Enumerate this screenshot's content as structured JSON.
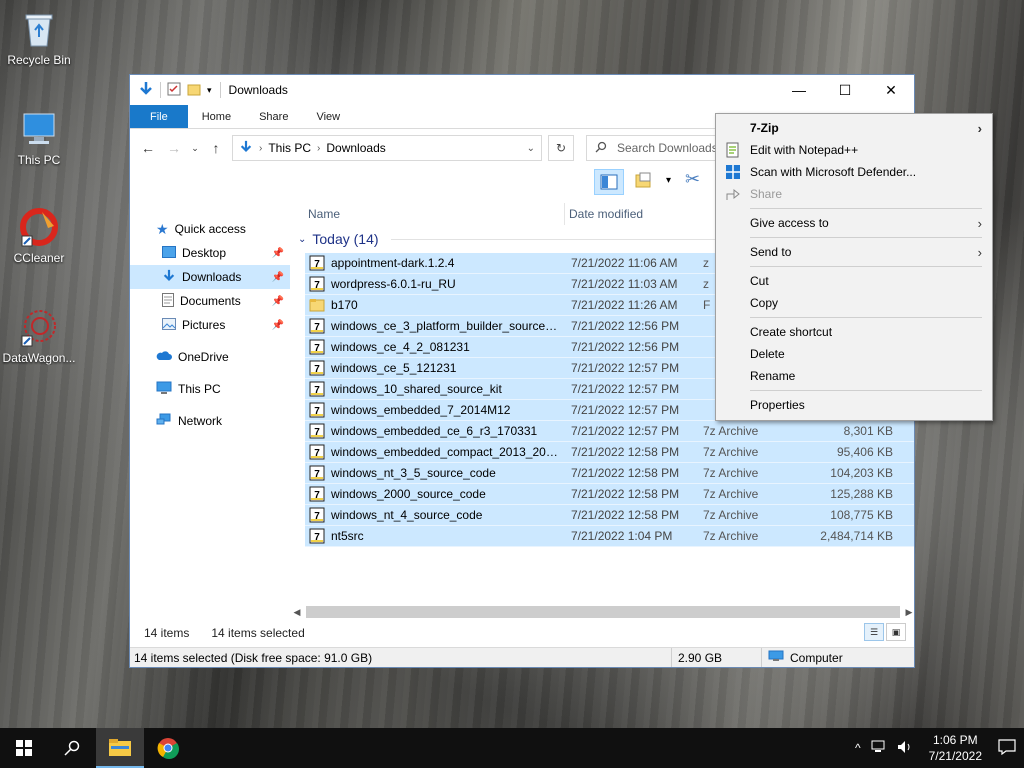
{
  "desktop": {
    "icons": [
      {
        "label": "Recycle Bin",
        "icon": "recycle-bin-icon"
      },
      {
        "label": "This PC",
        "icon": "computer-icon"
      },
      {
        "label": "CCleaner",
        "icon": "ccleaner-icon"
      },
      {
        "label": "DataWagon...",
        "icon": "datawagon-icon"
      }
    ]
  },
  "window": {
    "title": "Downloads",
    "controls": {
      "minimize": "—",
      "maximize": "☐",
      "close": "✕"
    },
    "ribbon_tabs": [
      "File",
      "Home",
      "Share",
      "View"
    ],
    "address": {
      "root": "This PC",
      "current": "Downloads"
    },
    "search_placeholder": "Search Downloads"
  },
  "nav_pane": {
    "items": [
      {
        "label": "Quick access",
        "icon": "star-icon"
      },
      {
        "label": "Desktop",
        "icon": "desktop-folder-icon"
      },
      {
        "label": "Downloads",
        "icon": "download-arrow-icon"
      },
      {
        "label": "Documents",
        "icon": "documents-icon"
      },
      {
        "label": "Pictures",
        "icon": "pictures-icon"
      },
      {
        "label": "OneDrive",
        "icon": "onedrive-icon"
      },
      {
        "label": "This PC",
        "icon": "computer-icon"
      },
      {
        "label": "Network",
        "icon": "network-icon"
      }
    ]
  },
  "columns": {
    "name": "Name",
    "date": "Date modified"
  },
  "group": {
    "label": "Today (14)"
  },
  "files": [
    {
      "name": "appointment-dark.1.2.4",
      "date": "7/21/2022 11:06 AM",
      "type": "z",
      "size": "",
      "kind": "archive"
    },
    {
      "name": "wordpress-6.0.1-ru_RU",
      "date": "7/21/2022 11:03 AM",
      "type": "z",
      "size": "",
      "kind": "archive"
    },
    {
      "name": "b170",
      "date": "7/21/2022 11:26 AM",
      "type": "F",
      "size": "",
      "kind": "folder"
    },
    {
      "name": "windows_ce_3_platform_builder_source_...",
      "date": "7/21/2022 12:56 PM",
      "type": "",
      "size": "",
      "kind": "archive"
    },
    {
      "name": "windows_ce_4_2_081231",
      "date": "7/21/2022 12:56 PM",
      "type": "",
      "size": "",
      "kind": "archive"
    },
    {
      "name": "windows_ce_5_121231",
      "date": "7/21/2022 12:57 PM",
      "type": "",
      "size": "",
      "kind": "archive"
    },
    {
      "name": "windows_10_shared_source_kit",
      "date": "7/21/2022 12:57 PM",
      "type": "",
      "size": "",
      "kind": "archive"
    },
    {
      "name": "windows_embedded_7_2014M12",
      "date": "7/21/2022 12:57 PM",
      "type": "",
      "size": "",
      "kind": "archive"
    },
    {
      "name": "windows_embedded_ce_6_r3_170331",
      "date": "7/21/2022 12:57 PM",
      "type": "7z Archive",
      "size": "8,301 KB",
      "kind": "archive"
    },
    {
      "name": "windows_embedded_compact_2013_201...",
      "date": "7/21/2022 12:58 PM",
      "type": "7z Archive",
      "size": "95,406 KB",
      "kind": "archive"
    },
    {
      "name": "windows_nt_3_5_source_code",
      "date": "7/21/2022 12:58 PM",
      "type": "7z Archive",
      "size": "104,203 KB",
      "kind": "archive"
    },
    {
      "name": "windows_2000_source_code",
      "date": "7/21/2022 12:58 PM",
      "type": "7z Archive",
      "size": "125,288 KB",
      "kind": "archive"
    },
    {
      "name": "windows_nt_4_source_code",
      "date": "7/21/2022 12:58 PM",
      "type": "7z Archive",
      "size": "108,775 KB",
      "kind": "archive"
    },
    {
      "name": "nt5src",
      "date": "7/21/2022 1:04 PM",
      "type": "7z Archive",
      "size": "2,484,714 KB",
      "kind": "archive"
    }
  ],
  "status": {
    "item_count": "14 items",
    "selected_count": "14 items selected",
    "detail": "14 items selected (Disk free space: 91.0 GB)",
    "size": "2.90 GB",
    "location": "Computer"
  },
  "context_menu": {
    "items": [
      {
        "label": "7-Zip",
        "bold": true,
        "submenu": true,
        "icon": "",
        "disabled": false
      },
      {
        "label": "Edit with Notepad++",
        "icon": "notepad-plus-icon",
        "disabled": false
      },
      {
        "label": "Scan with Microsoft Defender...",
        "icon": "defender-shield-icon",
        "disabled": false
      },
      {
        "label": "Share",
        "icon": "share-icon",
        "disabled": true
      },
      {
        "sep": true
      },
      {
        "label": "Give access to",
        "submenu": true,
        "disabled": false
      },
      {
        "sep": true
      },
      {
        "label": "Send to",
        "submenu": true,
        "disabled": false
      },
      {
        "sep": true
      },
      {
        "label": "Cut",
        "disabled": false
      },
      {
        "label": "Copy",
        "disabled": false
      },
      {
        "sep": true
      },
      {
        "label": "Create shortcut",
        "disabled": false
      },
      {
        "label": "Delete",
        "disabled": false
      },
      {
        "label": "Rename",
        "disabled": false
      },
      {
        "sep": true
      },
      {
        "label": "Properties",
        "disabled": false
      }
    ]
  },
  "taskbar": {
    "clock_time": "1:06 PM",
    "clock_date": "7/21/2022"
  },
  "colors": {
    "accent": "#1979ca",
    "selection": "#cce8ff",
    "group_header": "#1e3287"
  }
}
